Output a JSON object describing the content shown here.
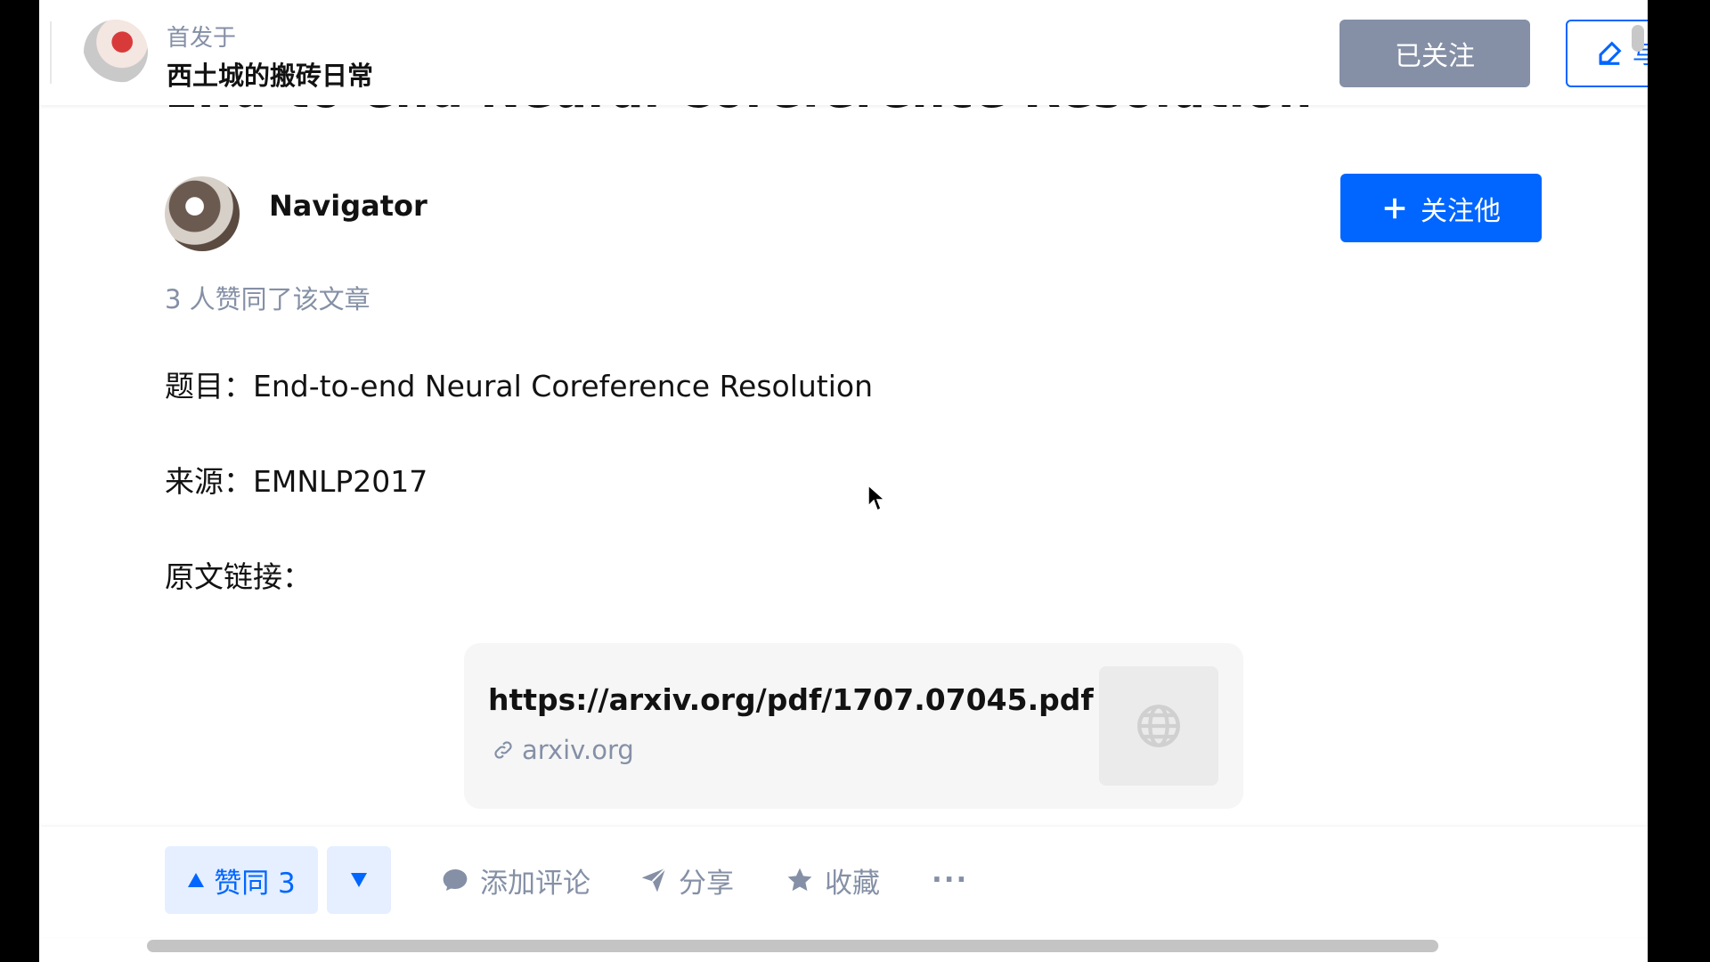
{
  "header": {
    "published_label": "首发于",
    "column_name": "西土城的搬砖日常",
    "followed_button": "已关注",
    "write_button": "写"
  },
  "article": {
    "title": "End-to-end Neural Coreference Resolution",
    "author": {
      "name": "Navigator"
    },
    "follow_button": "关注他",
    "likes_note": "3 人赞同了该文章",
    "paragraphs": [
      "题目：End-to-end Neural Coreference Resolution",
      "来源：EMNLP2017",
      "原文链接："
    ],
    "link_card": {
      "url": "https://arxiv.org/pdf/1707.07045.pdf",
      "domain": "arxiv.org"
    }
  },
  "actions": {
    "upvote": "赞同 3",
    "comment": "添加评论",
    "share": "分享",
    "favorite": "收藏",
    "more": "···"
  },
  "colors": {
    "brand_blue": "#0066ff",
    "muted_gray": "#8590a6",
    "upvote_bg": "#e5efff"
  }
}
